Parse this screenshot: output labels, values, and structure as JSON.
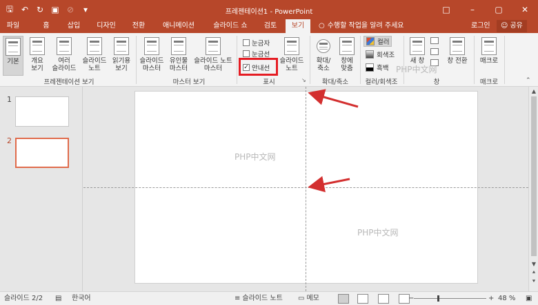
{
  "window": {
    "title": "프레젠테이션1 - PowerPoint",
    "qat_icons": [
      "save-icon",
      "undo-icon",
      "redo-icon",
      "start-from-beginning-icon",
      "disabled-icon",
      "customize-icon"
    ]
  },
  "tabs": [
    {
      "label": "파일",
      "active": false
    },
    {
      "label": "홈",
      "active": false
    },
    {
      "label": "삽입",
      "active": false
    },
    {
      "label": "디자인",
      "active": false
    },
    {
      "label": "전환",
      "active": false
    },
    {
      "label": "애니메이션",
      "active": false
    },
    {
      "label": "슬라이드 쇼",
      "active": false
    },
    {
      "label": "검토",
      "active": false
    },
    {
      "label": "보기",
      "active": true
    }
  ],
  "tell_me": "수행할 작업을 알려 주세요",
  "login": "로그인",
  "share": "공유",
  "ribbon": {
    "presentation_views": {
      "label": "프레젠테이션 보기",
      "buttons": [
        {
          "line1": "기본",
          "line2": ""
        },
        {
          "line1": "개요",
          "line2": "보기"
        },
        {
          "line1": "여러",
          "line2": "슬라이드"
        },
        {
          "line1": "슬라이드",
          "line2": "노트"
        },
        {
          "line1": "읽기용",
          "line2": "보기"
        }
      ]
    },
    "master_views": {
      "label": "마스터 보기",
      "buttons": [
        {
          "line1": "슬라이드",
          "line2": "마스터"
        },
        {
          "line1": "유인물",
          "line2": "마스터"
        },
        {
          "line1": "슬라이드 노트",
          "line2": "마스터"
        }
      ]
    },
    "show": {
      "label": "표시",
      "ruler": "눈금자",
      "gridlines": "눈금선",
      "guides": "안내선",
      "notes_button": {
        "line1": "슬라이드",
        "line2": "노트"
      }
    },
    "zoom": {
      "label": "확대/축소",
      "zoom_button": {
        "line1": "확대/",
        "line2": "축소"
      },
      "fit_button": {
        "line1": "창에",
        "line2": "맞춤"
      }
    },
    "color": {
      "label": "컬러/회색조",
      "color": "컬러",
      "grayscale": "회색조",
      "bw": "흑백"
    },
    "window": {
      "label": "창",
      "new_window": "새 창",
      "switch_window": "창 전환"
    },
    "macro": {
      "label": "매크로",
      "macro_button": "매크로"
    }
  },
  "slides": [
    {
      "number": "1"
    },
    {
      "number": "2"
    }
  ],
  "watermarks": {
    "ribbon": "PHP中文网",
    "slide_top": "PHP中文网",
    "slide_bottom": "PHP中文网"
  },
  "status": {
    "slide_count": "슬라이드 2/2",
    "language": "한국어",
    "notes": "슬라이드 노트",
    "comments": "메모",
    "zoom": "48 %"
  },
  "colors": {
    "accent": "#b7472a",
    "highlight_box": "#e51c23",
    "arrow": "#d32f2f"
  }
}
